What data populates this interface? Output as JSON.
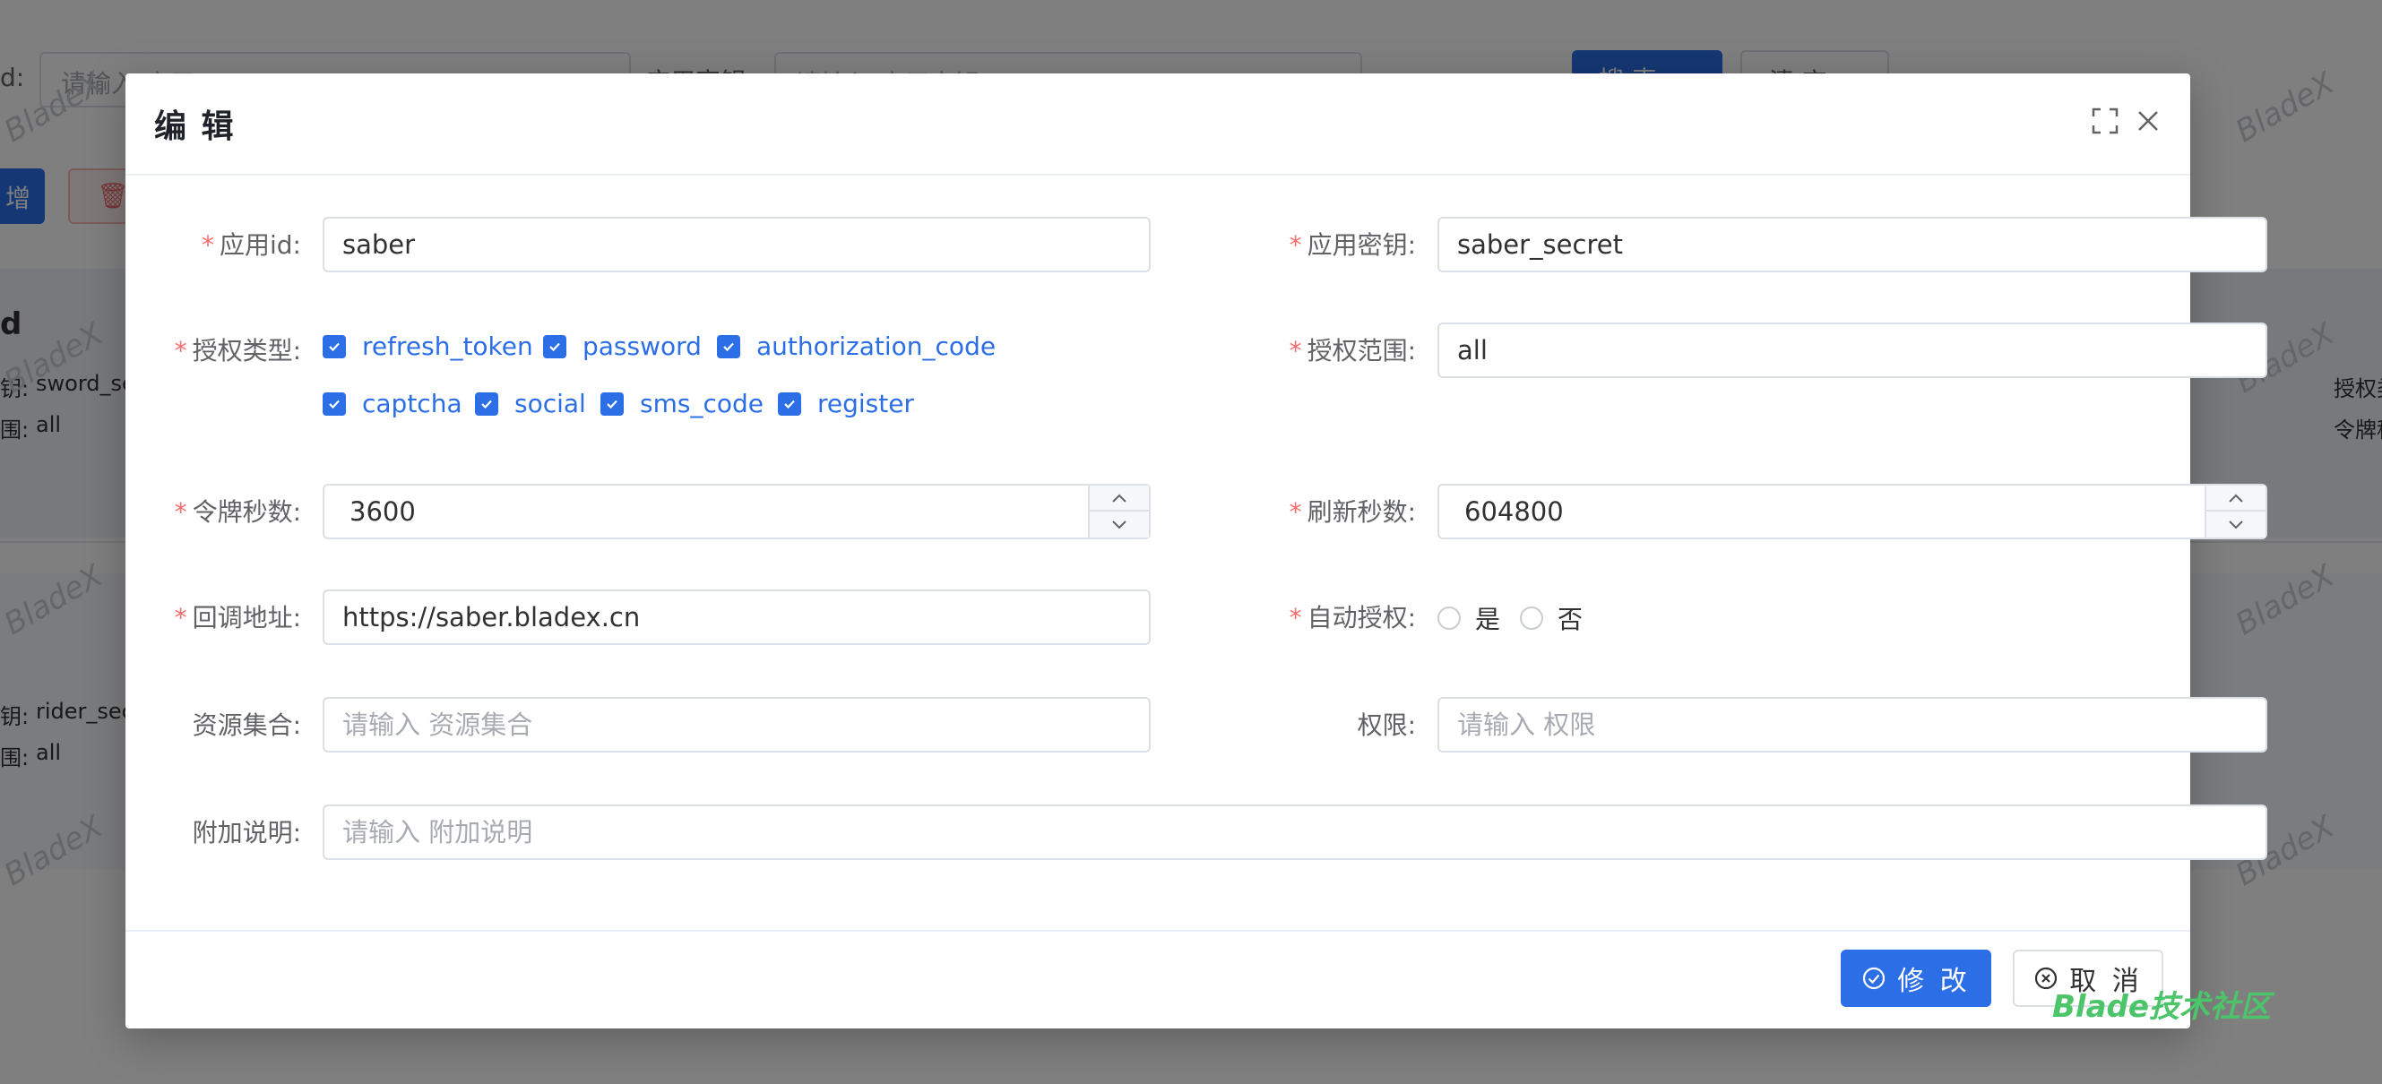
{
  "background": {
    "search_label_1": "d:",
    "search_placeholder_1": "请输入 应用id",
    "search_label_2": "应用密钥",
    "search_placeholder_2": "请输入 应用密钥",
    "search_button": "搜 索",
    "reset_button": "清 空",
    "add_button": "增",
    "card1": {
      "title": "d",
      "key_label": "钥:",
      "key_value": "sword_secret",
      "scope_label": "围:",
      "scope_value": "all"
    },
    "card2": {
      "key_label": "钥:",
      "key_value": "rider_secret",
      "scope_label": "围:",
      "scope_value": "all"
    },
    "right_col_1": "授权类",
    "right_col_2": "令牌秒",
    "watermark": "BladeX"
  },
  "dialog": {
    "title": "编 辑",
    "fields": {
      "client_id": {
        "label": "应用id:",
        "value": "saber"
      },
      "client_secret": {
        "label": "应用密钥:",
        "value": "saber_secret"
      },
      "grant_types": {
        "label": "授权类型:",
        "options": [
          "refresh_token",
          "password",
          "authorization_code",
          "captcha",
          "social",
          "sms_code",
          "register"
        ]
      },
      "scope": {
        "label": "授权范围:",
        "value": "all"
      },
      "access_token_validity": {
        "label": "令牌秒数:",
        "value": "3600"
      },
      "refresh_token_validity": {
        "label": "刷新秒数:",
        "value": "604800"
      },
      "redirect_uri": {
        "label": "回调地址:",
        "value": "https://saber.bladex.cn"
      },
      "auto_approve": {
        "label": "自动授权:",
        "options": [
          "是",
          "否"
        ]
      },
      "resource_ids": {
        "label": "资源集合:",
        "placeholder": "请输入 资源集合"
      },
      "authorities": {
        "label": "权限:",
        "placeholder": "请输入 权限"
      },
      "additional_info": {
        "label": "附加说明:",
        "placeholder": "请输入 附加说明"
      }
    },
    "footer": {
      "submit": "修 改",
      "cancel": "取 消"
    }
  },
  "corner_watermark": "Blade技术社区",
  "colors": {
    "primary": "#2b6ee6",
    "required": "#f56c6c",
    "watermark_green": "#4cc46a"
  }
}
